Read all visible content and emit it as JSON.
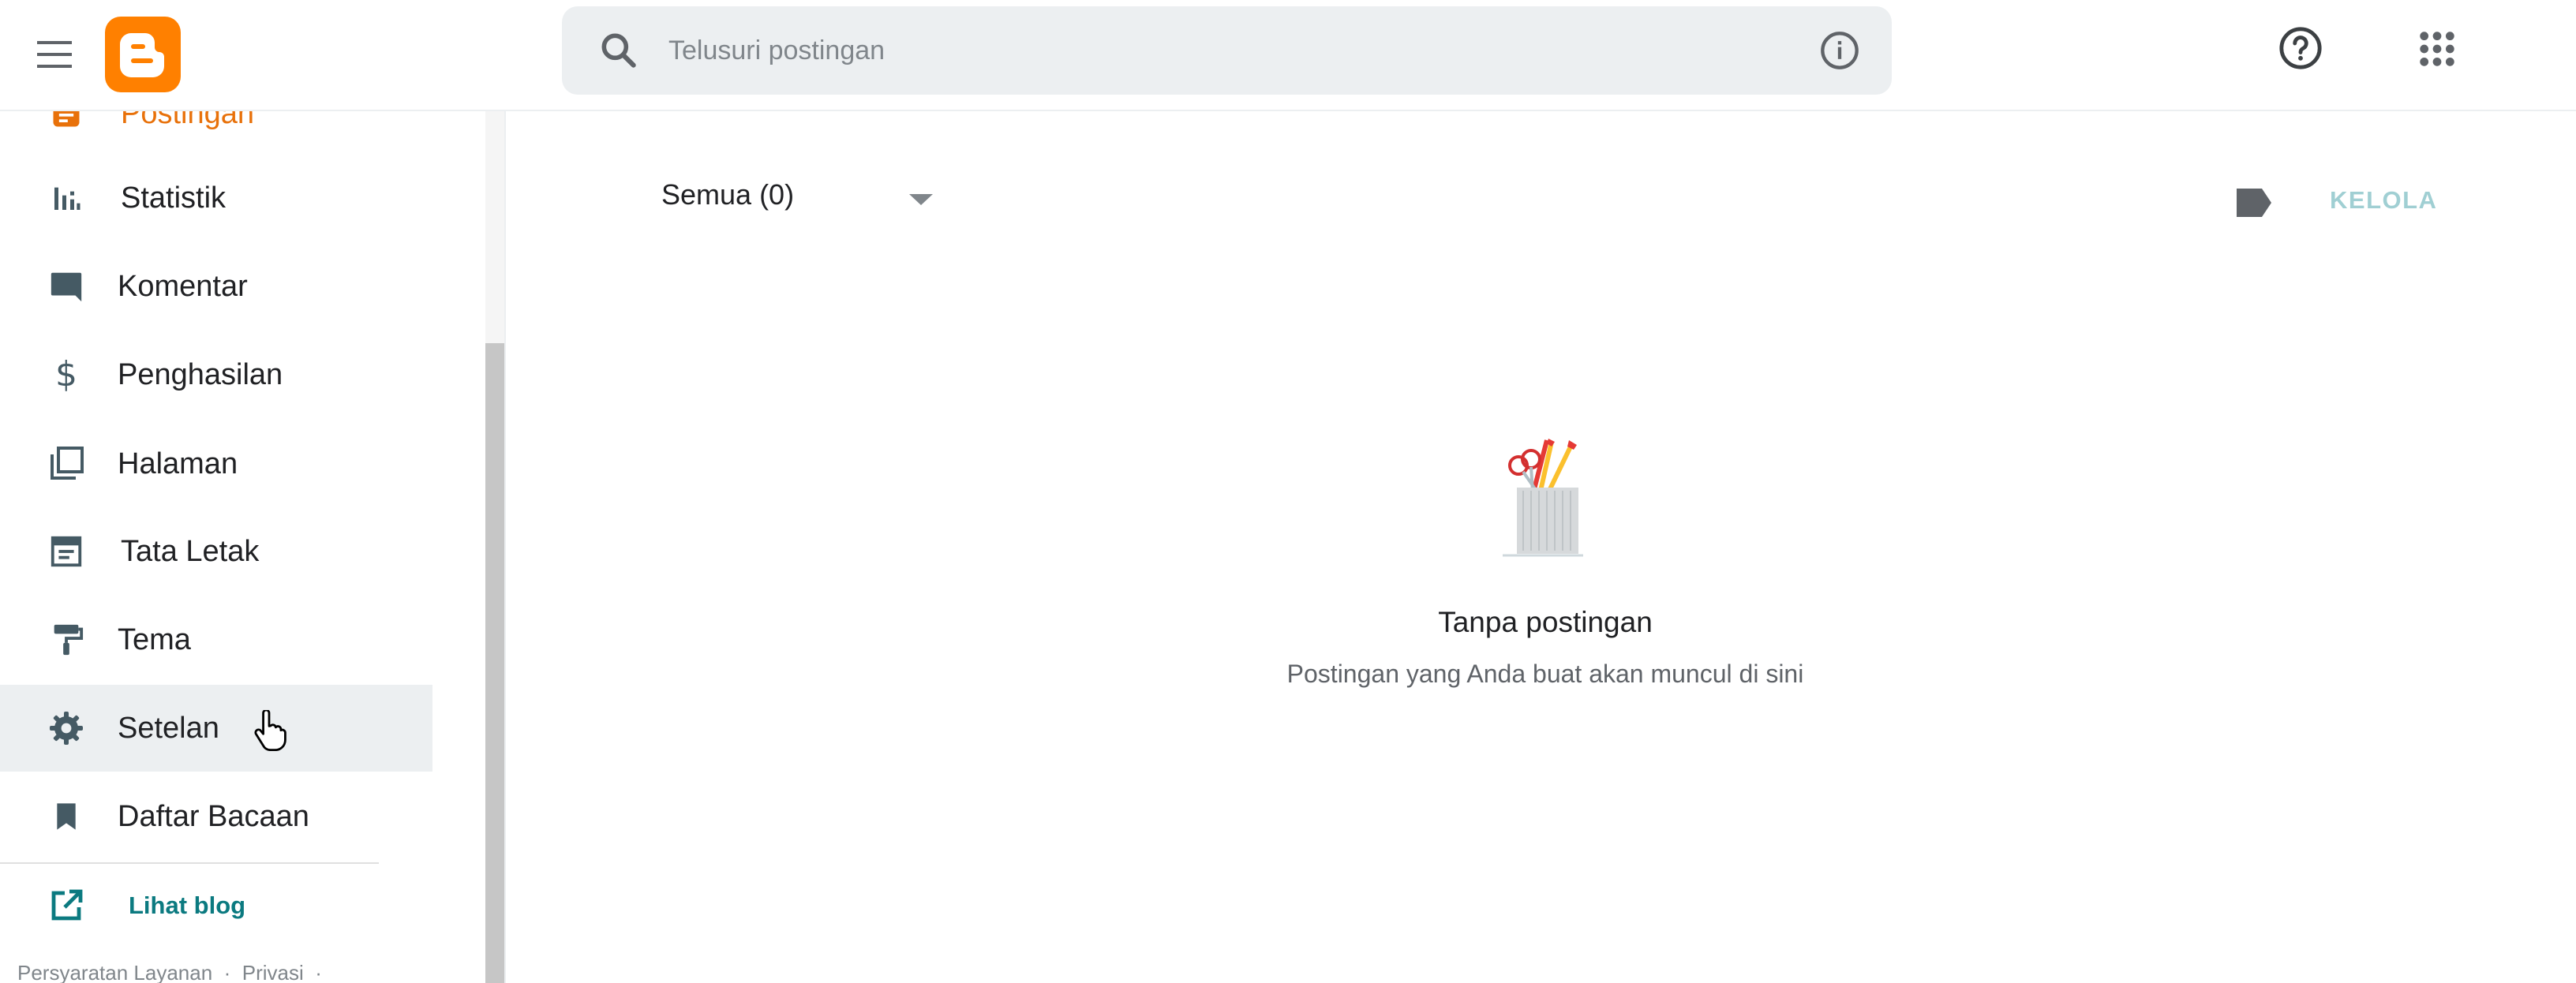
{
  "header": {
    "search_placeholder": "Telusuri postingan",
    "icons": {
      "menu": "menu-icon",
      "logo": "blogger-logo",
      "search": "search-icon",
      "info": "info-icon",
      "help": "help-icon",
      "apps": "apps-grid-icon"
    },
    "logo_color": "#ff8000"
  },
  "sidebar": {
    "items": [
      {
        "label": "Postingan",
        "icon": "posts-icon"
      },
      {
        "label": "Statistik",
        "icon": "bar-chart-icon"
      },
      {
        "label": "Komentar",
        "icon": "comment-icon"
      },
      {
        "label": "Penghasilan",
        "icon": "dollar-icon"
      },
      {
        "label": "Halaman",
        "icon": "pages-icon"
      },
      {
        "label": "Tata Letak",
        "icon": "layout-icon"
      },
      {
        "label": "Tema",
        "icon": "paint-roller-icon"
      },
      {
        "label": "Setelan",
        "icon": "gear-icon"
      },
      {
        "label": "Daftar Bacaan",
        "icon": "bookmark-icon"
      }
    ],
    "active_item": "Setelan",
    "current_item": "Postingan",
    "view_blog": {
      "label": "Lihat blog",
      "icon": "open-in-new-icon"
    },
    "footer": {
      "terms": "Persyaratan Layanan",
      "privacy": "Privasi",
      "separator": "·"
    }
  },
  "main": {
    "filter_label": "Semua (0)",
    "manage_label": "KELOLA",
    "empty_title": "Tanpa postingan",
    "empty_subtitle": "Postingan yang Anda buat akan muncul di sini"
  },
  "colors": {
    "accent_orange": "#e8710a",
    "teal_link": "#0b7a80",
    "manage_disabled": "#a0cfd3",
    "active_bg": "#eceff1",
    "icon_gray": "#455a64"
  }
}
